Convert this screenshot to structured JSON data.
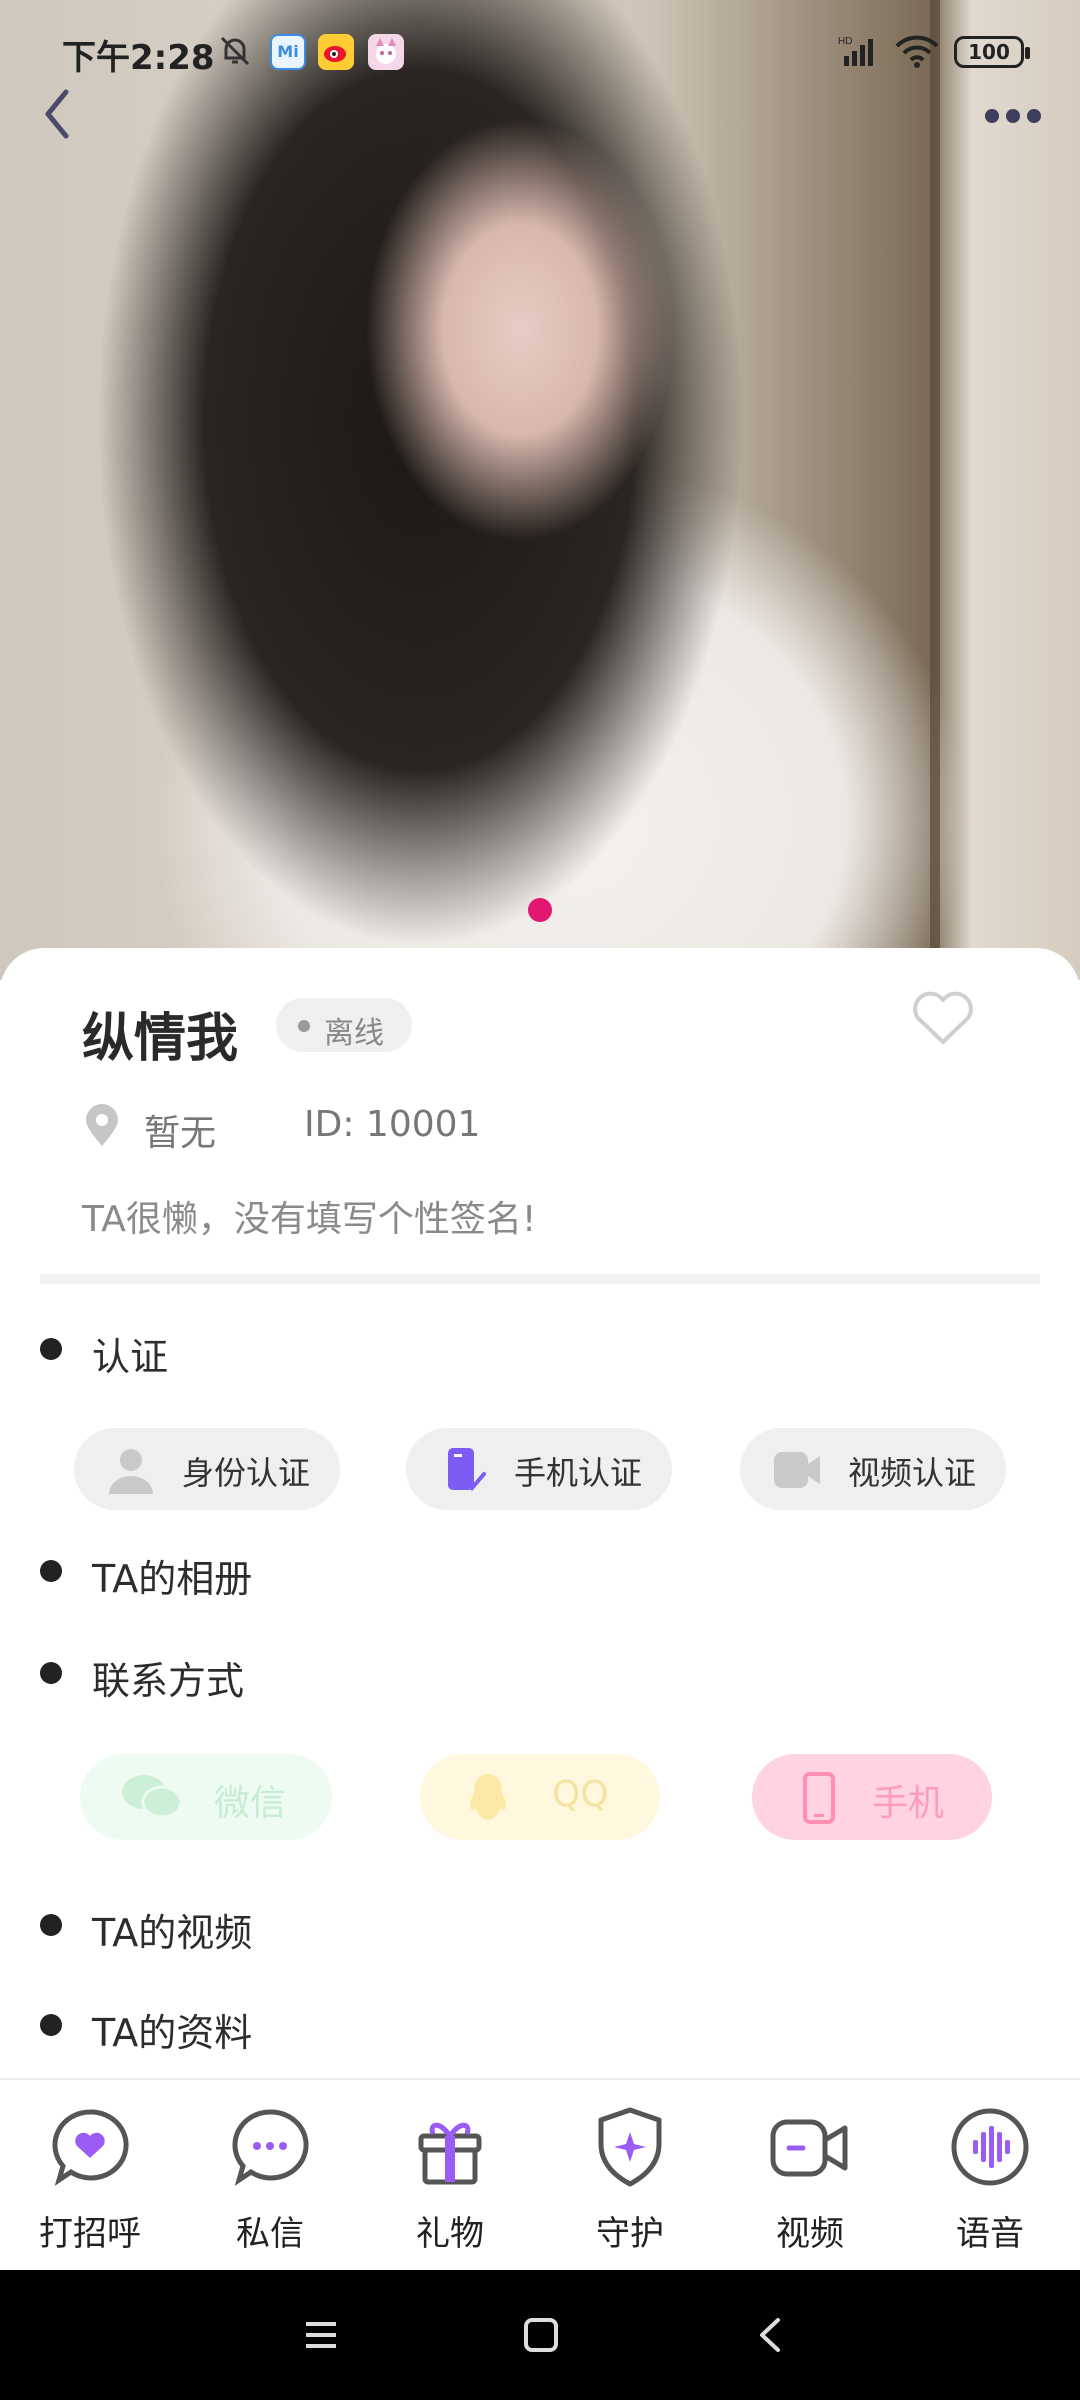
{
  "status_bar": {
    "time": "下午2:28",
    "mi_label": "Mi",
    "battery": "100"
  },
  "profile": {
    "name": "纵情我",
    "online_status": "离线",
    "location": "暂无",
    "id": "ID: 10001",
    "signature": "TA很懒，没有填写个性签名!"
  },
  "sections": {
    "certification": "认证",
    "album": "TA的相册",
    "contact": "联系方式",
    "videos": "TA的视频",
    "info": "TA的资料"
  },
  "certifications": [
    {
      "label": "身份认证",
      "icon": "person-icon"
    },
    {
      "label": "手机认证",
      "icon": "phone-check-icon"
    },
    {
      "label": "视频认证",
      "icon": "video-camera-icon"
    }
  ],
  "contacts": [
    {
      "label": "微信",
      "icon": "wechat-icon",
      "color": "#39c56a"
    },
    {
      "label": "QQ",
      "icon": "qq-icon",
      "color": "#f7c83a"
    },
    {
      "label": "手机",
      "icon": "phone-icon",
      "color": "#ff4f86"
    }
  ],
  "actions": [
    {
      "label": "打招呼",
      "icon": "heart-bubble-icon"
    },
    {
      "label": "私信",
      "icon": "message-icon"
    },
    {
      "label": "礼物",
      "icon": "gift-icon"
    },
    {
      "label": "守护",
      "icon": "shield-star-icon"
    },
    {
      "label": "视频",
      "icon": "video-call-icon"
    },
    {
      "label": "语音",
      "icon": "voice-icon"
    }
  ],
  "colors": {
    "accent": "#8b5cf6",
    "page_indicator": "#e2176f"
  }
}
